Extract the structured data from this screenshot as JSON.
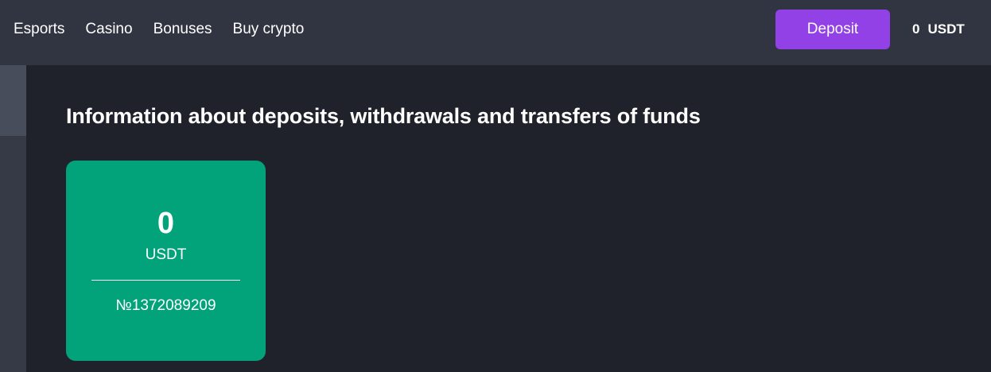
{
  "header": {
    "nav": [
      "Esports",
      "Casino",
      "Bonuses",
      "Buy crypto"
    ],
    "deposit_label": "Deposit",
    "balance_amount": "0",
    "balance_currency": "USDT"
  },
  "main": {
    "title": "Information about deposits, withdrawals and transfers of funds",
    "account_card": {
      "amount": "0",
      "currency": "USDT",
      "account_number": "№1372089209"
    }
  },
  "colors": {
    "topbar": "#313541",
    "background": "#1f222a",
    "deposit_button": "#9241e6",
    "card": "#02a37a"
  }
}
